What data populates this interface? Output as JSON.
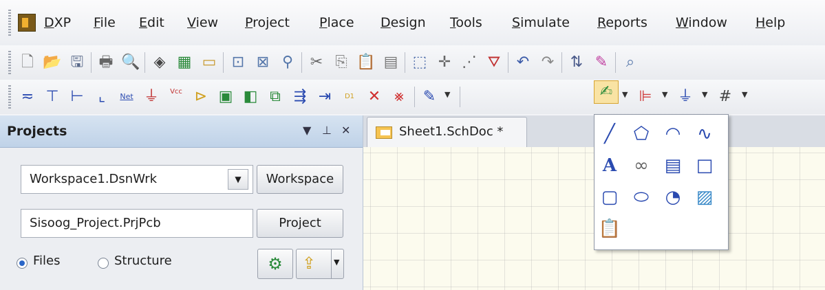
{
  "menubar": {
    "items": [
      "DXP",
      "File",
      "Edit",
      "View",
      "Project",
      "Place",
      "Design",
      "Tools",
      "Simulate",
      "Reports",
      "Window",
      "Help"
    ]
  },
  "toolbar1_icons": [
    "new-document-icon",
    "open-folder-icon",
    "save-icon",
    "print-icon",
    "print-preview-icon",
    "3d-chip-icon",
    "pcb-board-icon",
    "window-icon",
    "zoom-fit-icon",
    "zoom-area-icon",
    "zoom-selected-icon",
    "cut-icon",
    "copy-icon",
    "paste-icon",
    "rubber-stamp-icon",
    "select-area-icon",
    "move-icon",
    "deselect-icon",
    "clear-filter-icon",
    "undo-icon",
    "redo-icon",
    "cross-probe-icon",
    "highlight-pen-icon",
    "browse-icon"
  ],
  "toolbar2": {
    "net_label": "Net",
    "vcc_label": "Vcc",
    "d1_label": "D1"
  },
  "projects_panel": {
    "title": "Projects",
    "workspace_value": "Workspace1.DsnWrk",
    "workspace_button": "Workspace",
    "project_value": "Sisoog_Project.PrjPcb",
    "project_button": "Project",
    "radio_files": "Files",
    "radio_structure": "Structure"
  },
  "document": {
    "tab_label": "Sheet1.SchDoc *"
  },
  "drawing_tools": {
    "items": [
      "line-icon",
      "polygon-icon",
      "elliptical-arc-icon",
      "bezier-icon",
      "text-string-icon",
      "hyperlink-icon",
      "text-frame-icon",
      "rectangle-icon",
      "round-rectangle-icon",
      "ellipse-icon",
      "pie-chart-icon",
      "graphic-image-icon",
      "paste-array-icon"
    ]
  },
  "colors": {
    "panel_header": "#bfd2e8",
    "schematic_bg": "#fcfbee",
    "highlight": "#f9e3a4"
  }
}
